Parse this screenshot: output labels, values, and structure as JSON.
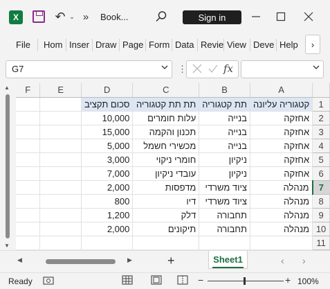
{
  "app": {
    "title": "Book...",
    "sign_in_label": "Sign in",
    "logo_letter": "X"
  },
  "ribbon": {
    "tabs": [
      "File",
      "Hom",
      "Inser",
      "Draw",
      "Page",
      "Form",
      "Data",
      "Revie",
      "View",
      "Deve",
      "Help"
    ],
    "more_icon": "chevron-right-icon"
  },
  "formula_bar": {
    "name_box": "G7",
    "fx_label": "fx",
    "formula_value": ""
  },
  "sheet": {
    "columns": [
      "F",
      "E",
      "D",
      "C",
      "B",
      "A"
    ],
    "rows": [
      [
        "",
        "",
        "סכום תקציב",
        "תת תת קטגוריה",
        "תת קטגוריה",
        "קטגוריה עליונה"
      ],
      [
        "",
        "",
        "10,000",
        "עלות חומרים",
        "בנייה",
        "אחזקה"
      ],
      [
        "",
        "",
        "15,000",
        "תכנון והקמה",
        "בנייה",
        "אחזקה"
      ],
      [
        "",
        "",
        "5,000",
        "מכשירי חשמל",
        "בנייה",
        "אחזקה"
      ],
      [
        "",
        "",
        "3,000",
        "חומרי ניקוי",
        "ניקיון",
        "אחזקה"
      ],
      [
        "",
        "",
        "7,000",
        "עובדי ניקיון",
        "ניקיון",
        "אחזקה"
      ],
      [
        "",
        "",
        "2,000",
        "מדפסות",
        "ציוד משרדי",
        "מנהלה"
      ],
      [
        "",
        "",
        "800",
        "דיו",
        "ציוד משרדי",
        "מנהלה"
      ],
      [
        "",
        "",
        "1,200",
        "דלק",
        "תחבורה",
        "מנהלה"
      ],
      [
        "",
        "",
        "2,000",
        "תיקונים",
        "תחבורה",
        "מנהלה"
      ],
      [
        "",
        "",
        "",
        "",
        "",
        ""
      ]
    ],
    "row_numbers": [
      "1",
      "2",
      "3",
      "4",
      "5",
      "6",
      "7",
      "8",
      "9",
      "10",
      "11"
    ],
    "active_row": "7",
    "tab_name": "Sheet1"
  },
  "status": {
    "ready": "Ready",
    "zoom": "100%"
  }
}
